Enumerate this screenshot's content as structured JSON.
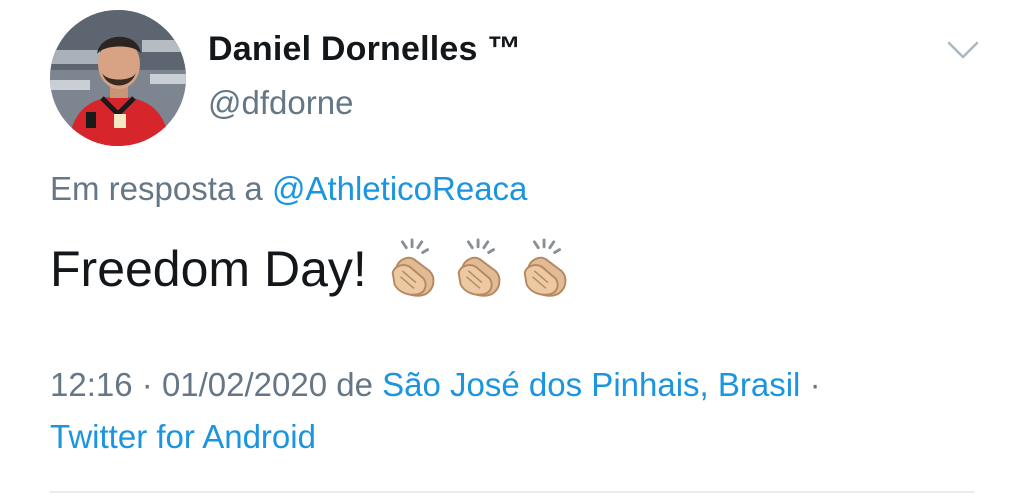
{
  "tweet": {
    "author": {
      "display_name": "Daniel Dornelles ™",
      "handle": "@dfdorne"
    },
    "reply_prefix": "Em resposta a",
    "reply_to": "@AthleticoReaca",
    "text": "Freedom Day!",
    "emojis": [
      "clapping-hands-medium-light",
      "clapping-hands-medium-light",
      "clapping-hands-medium-light"
    ],
    "time": "12:16",
    "separator": "·",
    "date": "01/02/2020",
    "location_prefix": "de",
    "location": "São José dos Pinhais, Brasil",
    "source": "Twitter for Android"
  },
  "icons": {
    "menu": "chevron-down-icon"
  },
  "colors": {
    "text": "#14171a",
    "secondary": "#657786",
    "link": "#1b95e0",
    "divider": "#e6ecf0"
  }
}
